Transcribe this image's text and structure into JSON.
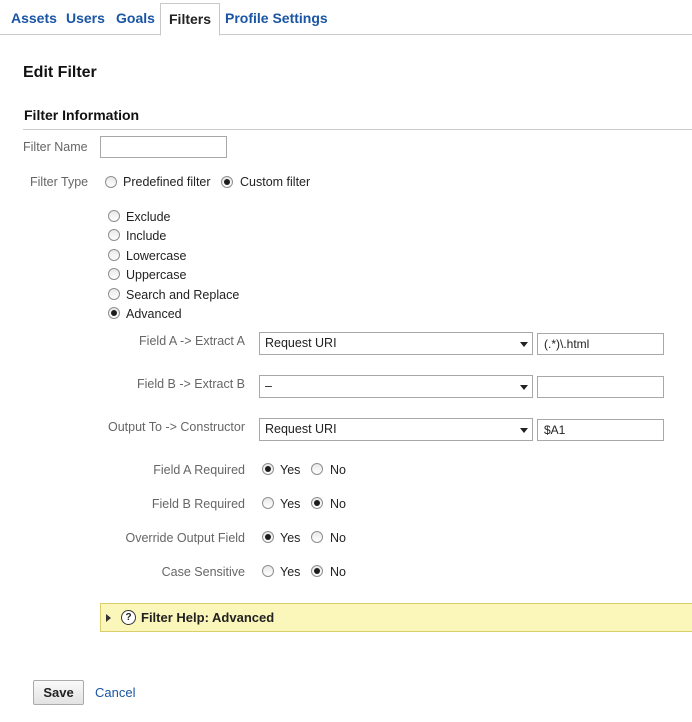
{
  "tabs": [
    {
      "label": "Assets"
    },
    {
      "label": "Users"
    },
    {
      "label": "Goals"
    },
    {
      "label": "Filters"
    },
    {
      "label": "Profile Settings"
    }
  ],
  "active_tab": "Filters",
  "page_title": "Edit Filter",
  "section_title": "Filter Information",
  "filter_name": {
    "label": "Filter Name",
    "value": ""
  },
  "filter_type": {
    "label": "Filter Type",
    "predefined": "Predefined filter",
    "custom": "Custom filter",
    "selected": "custom"
  },
  "custom_options": [
    {
      "label": "Exclude",
      "selected": false
    },
    {
      "label": "Include",
      "selected": false
    },
    {
      "label": "Lowercase",
      "selected": false
    },
    {
      "label": "Uppercase",
      "selected": false
    },
    {
      "label": "Search and Replace",
      "selected": false
    },
    {
      "label": "Advanced",
      "selected": true
    }
  ],
  "field_a": {
    "label": "Field A -> Extract A",
    "select": "Request URI",
    "value": "(.*)\\.html"
  },
  "field_b": {
    "label": "Field B -> Extract B",
    "select": "–",
    "value": ""
  },
  "output": {
    "label": "Output To -> Constructor",
    "select": "Request URI",
    "value": "$A1"
  },
  "yes_label": "Yes",
  "no_label": "No",
  "options": {
    "field_a_required": {
      "label": "Field A Required",
      "value": "Yes"
    },
    "field_b_required": {
      "label": "Field B Required",
      "value": "No"
    },
    "override_output": {
      "label": "Override Output Field",
      "value": "Yes"
    },
    "case_sensitive": {
      "label": "Case Sensitive",
      "value": "No"
    }
  },
  "help": {
    "icon": "?",
    "label": "Filter Help: Advanced"
  },
  "actions": {
    "save": "Save",
    "cancel": "Cancel"
  },
  "colors": {
    "link": "#1a55a4",
    "help_bg": "#fbf6b9"
  }
}
